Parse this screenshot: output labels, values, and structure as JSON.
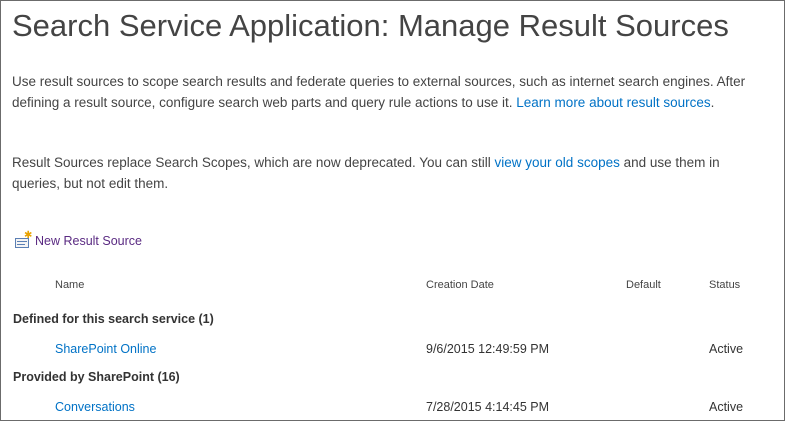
{
  "page": {
    "title": "Search Service Application: Manage Result Sources"
  },
  "description": {
    "para1_text": "Use result sources to scope search results and federate queries to external sources, such as internet search engines. After defining a result source, configure search web parts and query rule actions to use it. ",
    "para1_link": "Learn more about result sources",
    "para1_end": ".",
    "para2_text": "Result Sources replace Search Scopes, which are now deprecated. You can still ",
    "para2_link": "view your old scopes",
    "para2_end": " and use them in queries, but not edit them."
  },
  "toolbar": {
    "new_label": "New Result Source"
  },
  "table": {
    "columns": {
      "name": "Name",
      "creation_date": "Creation Date",
      "default": "Default",
      "status": "Status"
    },
    "groups": [
      {
        "label": "Defined for this search service (1)",
        "rows": [
          {
            "name": "SharePoint Online",
            "creation_date": "9/6/2015 12:49:59 PM",
            "default": "",
            "status": "Active"
          }
        ]
      },
      {
        "label": "Provided by SharePoint (16)",
        "rows": [
          {
            "name": "Conversations",
            "creation_date": "7/28/2015 4:14:45 PM",
            "default": "",
            "status": "Active"
          }
        ]
      }
    ]
  },
  "colors": {
    "link": "#0072c6",
    "new_link": "#5a2a82",
    "text": "#444444",
    "border": "#6b6b6b"
  }
}
